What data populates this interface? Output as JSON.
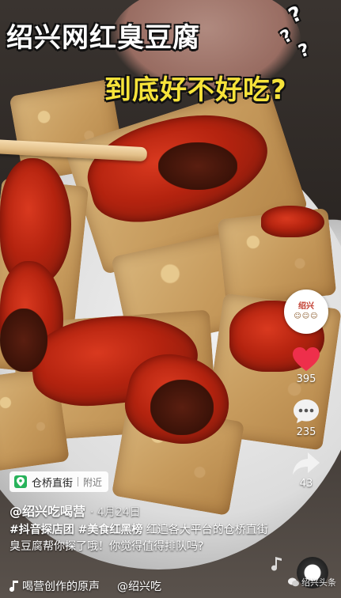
{
  "video": {
    "title_line1": "绍兴网红臭豆腐",
    "title_line2": "到底好不好吃?",
    "question_marks": [
      "?",
      "?",
      "?"
    ]
  },
  "sidebar": {
    "avatar_text": "绍兴",
    "likes_count": "395",
    "comments_count": "235",
    "shares_count": "43"
  },
  "location": {
    "name": "仓桥直街",
    "tag": "附近"
  },
  "post": {
    "author": "@绍兴吃喝营",
    "date": "· 4月24日",
    "caption_hashtags": "#抖音探店团 #美食红黑榜",
    "caption_text": " 红遍各大平台的仓桥直街臭豆腐帮你探了哦！你觉得值得排队吗?"
  },
  "music": {
    "text": "喝营创作的原声",
    "author": "@绍兴吃"
  },
  "watermark": {
    "text": "绍兴头条"
  },
  "colors": {
    "title_yellow": "#f6e33a",
    "like_red": "#ee2f4b",
    "location_green": "#27b25a"
  }
}
